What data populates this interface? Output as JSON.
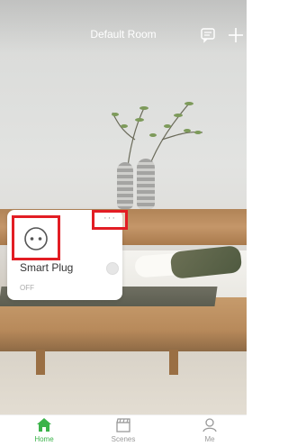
{
  "header": {
    "title": "Default Room",
    "message_icon": "message-icon",
    "add_icon": "plus-icon"
  },
  "device_card": {
    "name": "Smart Plug",
    "status": "OFF",
    "icon": "plug-icon",
    "more_label": "···",
    "toggle_state": "off"
  },
  "tabs": [
    {
      "label": "Home",
      "icon": "home-icon",
      "active": true
    },
    {
      "label": "Scenes",
      "icon": "scenes-icon",
      "active": false
    },
    {
      "label": "Me",
      "icon": "person-icon",
      "active": false
    }
  ],
  "colors": {
    "accent": "#3bb34a",
    "highlight_border": "#e21d24",
    "tab_inactive": "#999999"
  }
}
